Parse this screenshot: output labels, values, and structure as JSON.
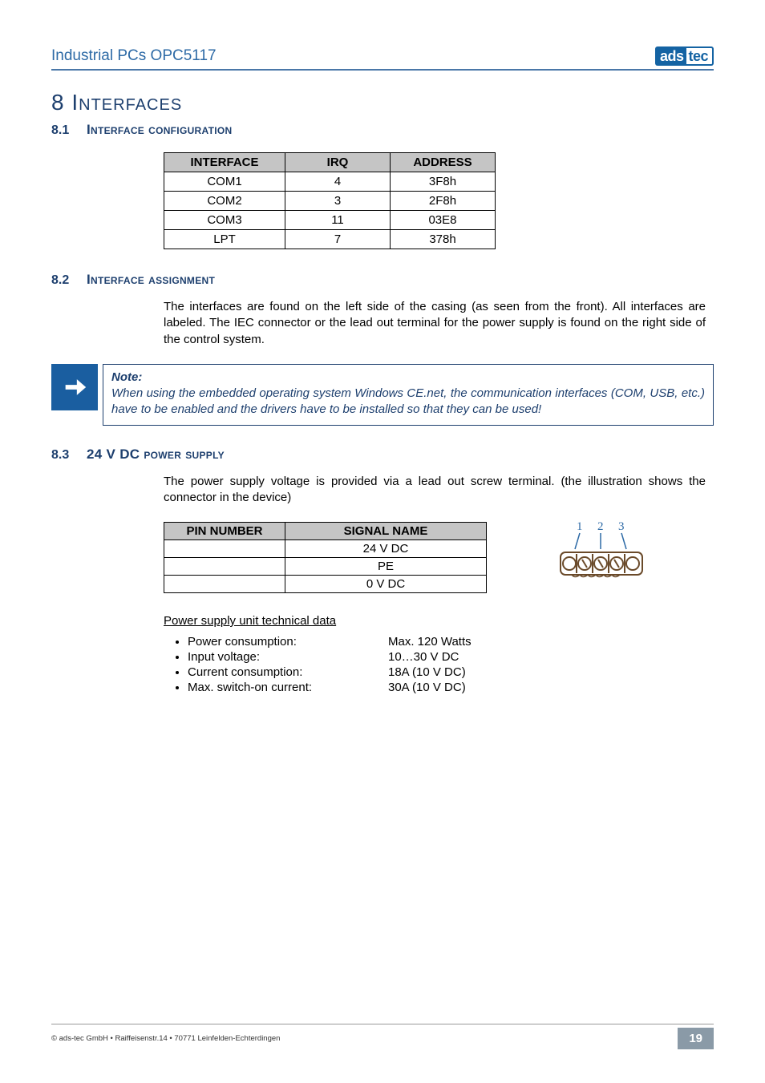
{
  "header": {
    "title": "Industrial PCs OPC5117",
    "logo_left": "ads",
    "logo_right": "tec"
  },
  "section": {
    "num": "8",
    "title": "Interfaces"
  },
  "s81": {
    "num": "8.1",
    "title": "Interface configuration",
    "table": {
      "headers": [
        "INTERFACE",
        "IRQ",
        "ADDRESS"
      ],
      "rows": [
        [
          "COM1",
          "4",
          "3F8h"
        ],
        [
          "COM2",
          "3",
          "2F8h"
        ],
        [
          "COM3",
          "11",
          "03E8"
        ],
        [
          "LPT",
          "7",
          "378h"
        ]
      ]
    }
  },
  "s82": {
    "num": "8.2",
    "title": "Interface assignment",
    "body": "The interfaces are found on the left side of the casing (as seen from the front). All interfaces are labeled. The IEC connector or the lead out terminal for the power supply is found on the right side of the control system.",
    "note_head": "Note:",
    "note_body": "When using the embedded operating system Windows CE.net, the communication interfaces (COM, USB, etc.) have to be enabled and the drivers have to be installed so that they can be used!"
  },
  "s83": {
    "num": "8.3",
    "title": "24 V DC power supply",
    "body": "The power supply voltage is provided via a lead out screw terminal. (the illustration shows the connector in the device)",
    "table": {
      "headers": [
        "PIN NUMBER",
        "SIGNAL NAME"
      ],
      "rows": [
        [
          "",
          "24 V DC"
        ],
        [
          "",
          "PE"
        ],
        [
          "",
          "0 V DC"
        ]
      ]
    },
    "conn_labels": [
      "1",
      "2",
      "3"
    ],
    "psu_head": "Power supply unit technical data",
    "psu": [
      {
        "label": "Power consumption:",
        "val": "Max. 120 Watts"
      },
      {
        "label": "Input voltage:",
        "val": "10…30 V DC"
      },
      {
        "label": "Current consumption:",
        "val": "18A (10 V DC)"
      },
      {
        "label": "Max. switch-on current:",
        "val": "30A (10 V DC)"
      }
    ]
  },
  "footer": {
    "left": "© ads-tec GmbH • Raiffeisenstr.14 • 70771 Leinfelden-Echterdingen",
    "page": "19"
  }
}
